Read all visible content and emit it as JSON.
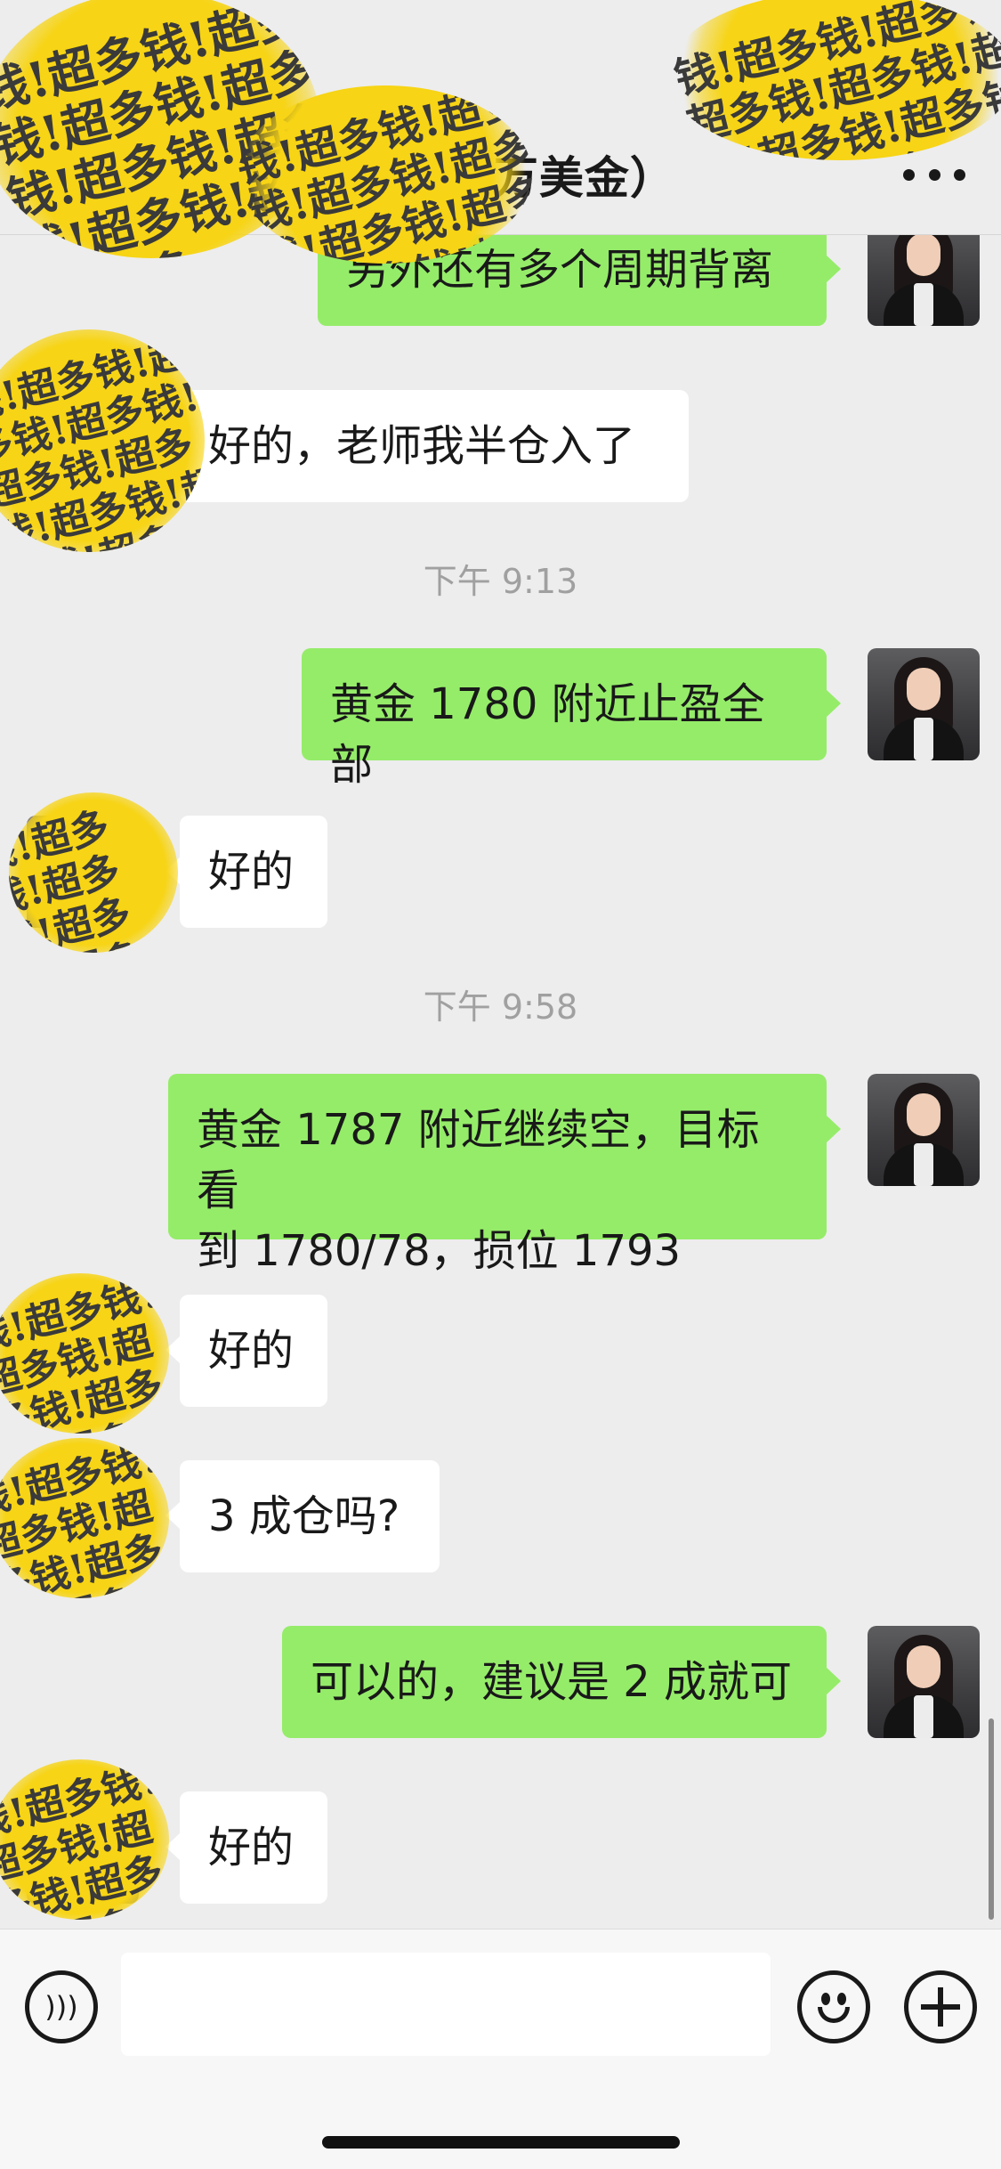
{
  "header": {
    "title": "上　　6万美金）",
    "more_icon": "more-horizontal-icon"
  },
  "messages": [
    {
      "id": "m1",
      "direction": "outgoing",
      "text": "另外还有多个周期背离"
    },
    {
      "id": "m2",
      "direction": "incoming",
      "text": "好的，老师我半仓入了"
    },
    {
      "id": "t1",
      "type": "timestamp",
      "text": "下午 9:13"
    },
    {
      "id": "m3",
      "direction": "outgoing",
      "text": "黄金 1780 附近止盈全部"
    },
    {
      "id": "m4",
      "direction": "incoming",
      "text": "好的"
    },
    {
      "id": "t2",
      "type": "timestamp",
      "text": "下午 9:58"
    },
    {
      "id": "m5",
      "direction": "outgoing",
      "text_line1": "黄金 1787 附近继续空，目标看",
      "text_line2": "到 1780/78，损位 1793"
    },
    {
      "id": "m6",
      "direction": "incoming",
      "text": "好的"
    },
    {
      "id": "m7",
      "direction": "incoming",
      "text": "3 成仓吗?"
    },
    {
      "id": "m8",
      "direction": "outgoing",
      "text": "可以的，建议是 2 成就可"
    },
    {
      "id": "m9",
      "direction": "incoming",
      "text": "好的"
    }
  ],
  "stickers": {
    "text": "钱!超多钱!超多钱!超多钱!超多钱!超多钱!超多钱!超多钱!超多钱!超多",
    "color": "#f7d415"
  },
  "input_bar": {
    "voice_icon": "voice-icon",
    "emoji_icon": "emoji-icon",
    "plus_icon": "plus-icon",
    "text_value": ""
  },
  "colors": {
    "outgoing_bubble": "#95ec69",
    "incoming_bubble": "#ffffff",
    "background": "#ededed"
  }
}
